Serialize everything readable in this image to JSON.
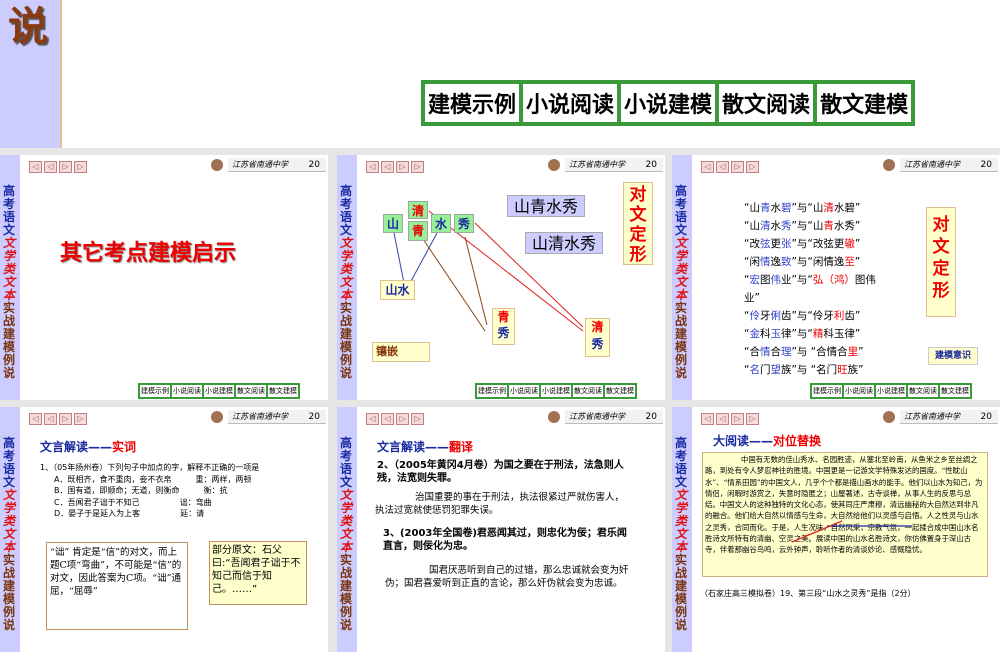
{
  "current_slide": {
    "side_char": "说",
    "nav": [
      "建模示例",
      "小说阅读",
      "小说建模",
      "散文阅读",
      "散文建模"
    ]
  },
  "common": {
    "side": [
      "高考语文",
      "文学类文本",
      "实战建模例说"
    ],
    "school": "江苏省南通中学",
    "num": "20",
    "nav": [
      "建模示例",
      "小说阅读",
      "小说建模",
      "散文阅读",
      "散文建模"
    ],
    "arrows": [
      "◁",
      "◁",
      "▷",
      "▷"
    ]
  },
  "slides": {
    "s1": {
      "title": "其它考点建模启示"
    },
    "s2": {
      "chars": {
        "qing_clear": "清",
        "shan": "山",
        "qing_green": "青",
        "shui": "水",
        "xiu": "秀"
      },
      "phrase1": "山青水秀",
      "phrase2": "山清水秀",
      "label": "对文定形",
      "shanshui": "山水",
      "qingxiu1": [
        "青",
        "秀"
      ],
      "qingxiu2": [
        "清",
        "秀"
      ],
      "tag": "镶嵌"
    },
    "s3": {
      "lines": [
        [
          [
            "“山",
            "k"
          ],
          [
            "青",
            "b"
          ],
          [
            "水",
            "k"
          ],
          [
            "碧",
            "b"
          ],
          [
            "”与“山",
            "k"
          ],
          [
            "清",
            "r"
          ],
          [
            "水碧”",
            "k"
          ]
        ],
        [
          [
            "“山",
            "k"
          ],
          [
            "清",
            "b"
          ],
          [
            "水",
            "k"
          ],
          [
            "秀",
            "b"
          ],
          [
            "”与“山",
            "k"
          ],
          [
            "青",
            "r"
          ],
          [
            "水秀”",
            "k"
          ]
        ],
        [
          [
            "“改",
            "k"
          ],
          [
            "弦",
            "b"
          ],
          [
            "更",
            "k"
          ],
          [
            "张",
            "b"
          ],
          [
            "”与“改弦更",
            "k"
          ],
          [
            "辙",
            "r"
          ],
          [
            "”",
            "k"
          ]
        ],
        [
          [
            "“闲",
            "k"
          ],
          [
            "情",
            "b"
          ],
          [
            "逸",
            "k"
          ],
          [
            "致",
            "b"
          ],
          [
            "”与“闲情逸",
            "k"
          ],
          [
            "至",
            "r"
          ],
          [
            "”",
            "k"
          ]
        ],
        [
          [
            "“",
            "k"
          ],
          [
            "宏",
            "b"
          ],
          [
            "图",
            "k"
          ],
          [
            "伟",
            "b"
          ],
          [
            "业”与“",
            "k"
          ],
          [
            "弘（鸿）",
            "r"
          ],
          [
            "图伟业”",
            "k"
          ]
        ],
        [
          [
            "“",
            "k"
          ],
          [
            "伶",
            "b"
          ],
          [
            "牙",
            "k"
          ],
          [
            "俐",
            "b"
          ],
          [
            "齿”与“伶牙",
            "k"
          ],
          [
            "利",
            "r"
          ],
          [
            "齿”",
            "k"
          ]
        ],
        [
          [
            "“",
            "k"
          ],
          [
            "金",
            "b"
          ],
          [
            "科",
            "k"
          ],
          [
            "玉",
            "b"
          ],
          [
            "律”与“",
            "k"
          ],
          [
            "精",
            "r"
          ],
          [
            "科玉律”",
            "k"
          ]
        ],
        [
          [
            "“合",
            "k"
          ],
          [
            "情",
            "b"
          ],
          [
            "合",
            "k"
          ],
          [
            "理",
            "b"
          ],
          [
            "”与 “合情合",
            "k"
          ],
          [
            "里",
            "r"
          ],
          [
            "”",
            "k"
          ]
        ],
        [
          [
            "“",
            "k"
          ],
          [
            "名",
            "b"
          ],
          [
            "门",
            "k"
          ],
          [
            "望",
            "b"
          ],
          [
            "族”与 “名门",
            "k"
          ],
          [
            "旺",
            "r"
          ],
          [
            "族”",
            "k"
          ]
        ]
      ],
      "label": "对文定形",
      "tag": "建模意识"
    },
    "s4": {
      "heading_a": "文言解读——",
      "heading_b": "实词",
      "q": "1、（05年扬州卷）下列句子中加点的字，解释不正确的一项是",
      "opts": [
        "A．既相齐，食不重肉，妾不衣帛　　　重：两样，两顿",
        "B．国有道，即顺命；无道，则衡命　　　衡：抗",
        "C．吾闻君子诎于不知己　　　　　诎：弯曲",
        "D．晏子于是延入为上客　　　　　延：请"
      ],
      "box1": "“诎” 肯定是“信”的对文，而上题C项“弯曲”，不可能是“信”的对文，因此答案为C项。“诎”通屈，“屈辱”",
      "box2": "部分原文：石父曰:“吾闻君子诎于不知己而信于知己。……”"
    },
    "s5": {
      "heading_a": "文言解读——",
      "heading_b": "翻译",
      "q2": "2、（2005年黄冈4月卷）为国之要在于刑法，法急则人残，法宽则失罪。",
      "a2": "治国重要的事在于刑法，执法很紧过严就伤害人，执法过宽就使惩罚犯罪失误。",
      "q3": "3、(2003年全国卷)君恶闻其过，则忠化为佞；君乐闻直言，则佞化为忠。",
      "a3": "国君厌恶听到自己的过错，那么忠诚就会变为奸伪；国君喜爱听到正直的言论，那么奸伪就会变为忠诚。"
    },
    "s6": {
      "heading_a": "大阅读——",
      "heading_b": "对位替换",
      "passage": "中国有无数的佳山秀水、名园胜迹，从塞北至岭南，从鱼米之乡至丝绸之路，到处有令人梦忍神往的胜境。中国更是一记游文学特殊发达的国度。“性眈山水”、“情系田园”的中国文人，几乎个个都是描山画水的能手。他们以山水为知己，为情侣，闲暇时游赏之，失意时隐匿之；山屋著述，古寺谈禅，从事人生的反思与总结。中国文人的这种独特的文化心态，使其同庄严肃穆，清远幽秘的大自然达到非凡的融合。他们给大自然以情感与生命，大自然给他们以灵感与启悟。人之性灵与山水之灵秀，合同而化。于是，人生况味，自然风采，宗教气氛，一起揉合成中国山水名胜诗文所特有的清幽、空灵之美。展读中国的山水名胜诗文，你仿佛置身于深山古寺，伴着那幽谷鸟鸣，云外钟声，聆听作者的清谈妙论、感慨隐忧。",
      "question": "（石家庄高三模拟卷）19、第三段“山水之灵秀”是指（2分）"
    }
  }
}
